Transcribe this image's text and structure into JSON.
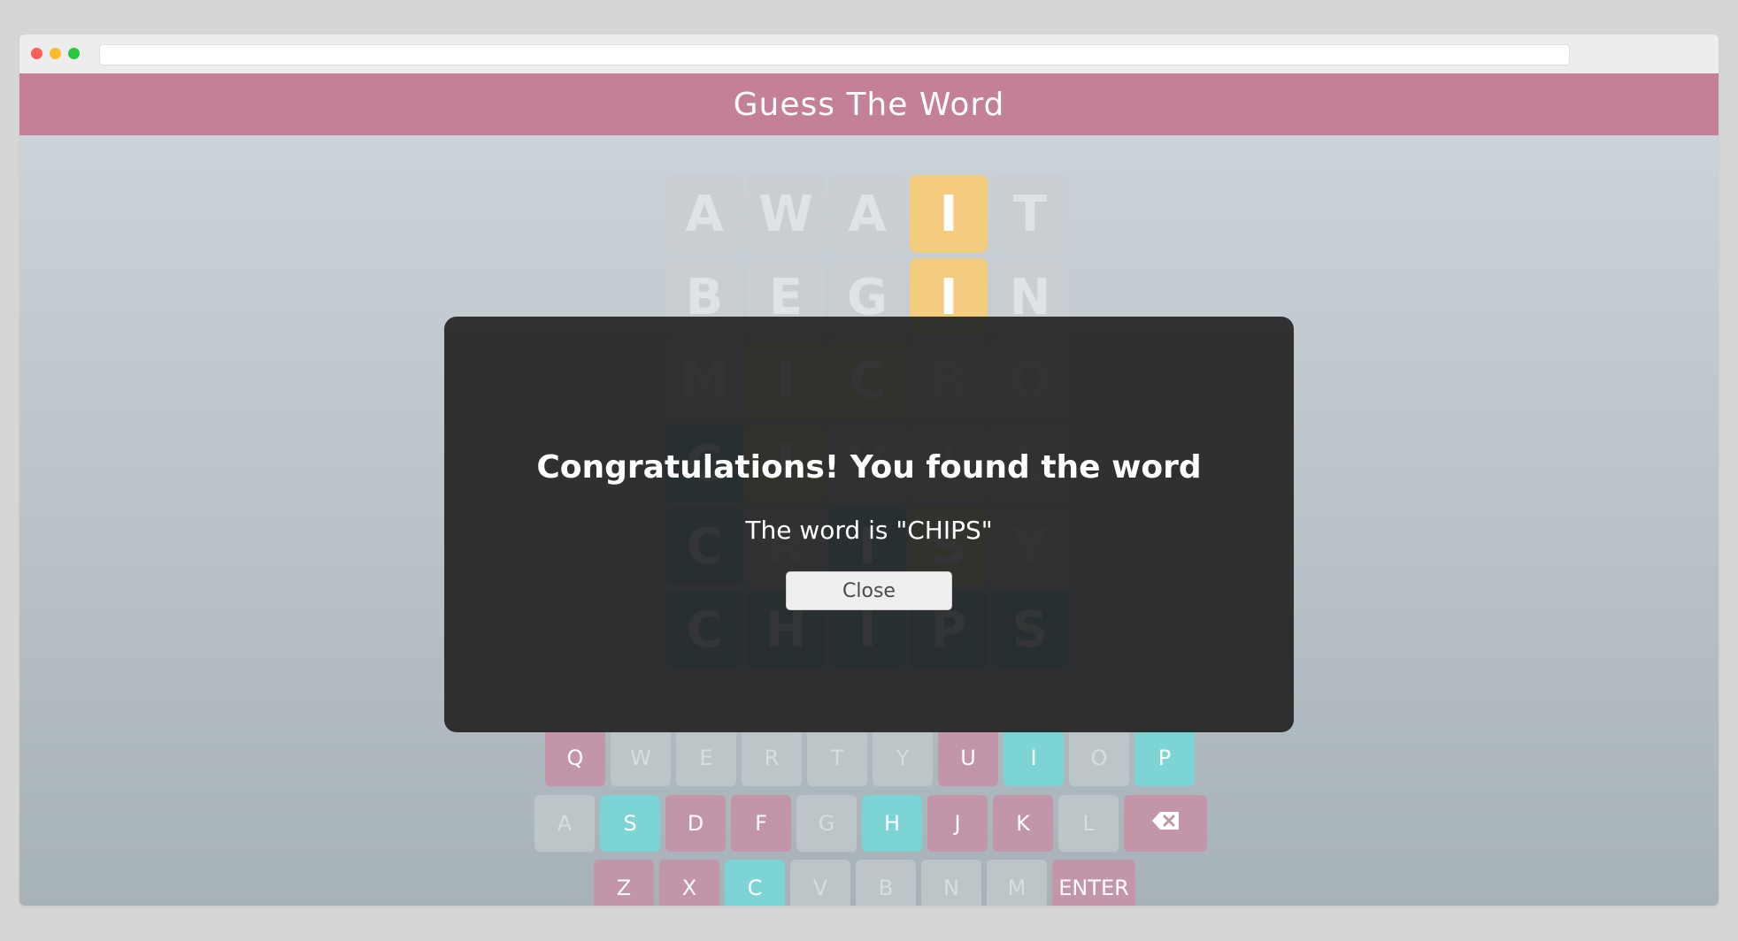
{
  "app": {
    "title": "Guess The Word"
  },
  "board": {
    "rows": [
      [
        {
          "l": "A",
          "s": "absent"
        },
        {
          "l": "W",
          "s": "absent"
        },
        {
          "l": "A",
          "s": "absent"
        },
        {
          "l": "I",
          "s": "present"
        },
        {
          "l": "T",
          "s": "absent"
        }
      ],
      [
        {
          "l": "B",
          "s": "absent"
        },
        {
          "l": "E",
          "s": "absent"
        },
        {
          "l": "G",
          "s": "absent"
        },
        {
          "l": "I",
          "s": "present"
        },
        {
          "l": "N",
          "s": "absent"
        }
      ],
      [
        {
          "l": "M",
          "s": "absent"
        },
        {
          "l": "I",
          "s": "present"
        },
        {
          "l": "C",
          "s": "present"
        },
        {
          "l": "R",
          "s": "absent"
        },
        {
          "l": "O",
          "s": "absent"
        }
      ],
      [
        {
          "l": "C",
          "s": "correct"
        },
        {
          "l": "I",
          "s": "present"
        },
        {
          "l": "V",
          "s": "absent"
        },
        {
          "l": "I",
          "s": "absent"
        },
        {
          "l": "L",
          "s": "absent"
        }
      ],
      [
        {
          "l": "C",
          "s": "correct"
        },
        {
          "l": "R",
          "s": "absent"
        },
        {
          "l": "I",
          "s": "correct"
        },
        {
          "l": "S",
          "s": "present"
        },
        {
          "l": "Y",
          "s": "absent"
        }
      ],
      [
        {
          "l": "C",
          "s": "correct"
        },
        {
          "l": "H",
          "s": "correct"
        },
        {
          "l": "I",
          "s": "correct"
        },
        {
          "l": "P",
          "s": "correct"
        },
        {
          "l": "S",
          "s": "correct"
        }
      ]
    ]
  },
  "keyboard": {
    "rows": [
      [
        {
          "k": "Q",
          "s": "pink"
        },
        {
          "k": "W",
          "s": "gray"
        },
        {
          "k": "E",
          "s": "gray"
        },
        {
          "k": "R",
          "s": "gray"
        },
        {
          "k": "T",
          "s": "gray"
        },
        {
          "k": "Y",
          "s": "gray"
        },
        {
          "k": "U",
          "s": "pink"
        },
        {
          "k": "I",
          "s": "teal"
        },
        {
          "k": "O",
          "s": "gray"
        },
        {
          "k": "P",
          "s": "teal"
        }
      ],
      [
        {
          "k": "A",
          "s": "gray"
        },
        {
          "k": "S",
          "s": "teal"
        },
        {
          "k": "D",
          "s": "pink"
        },
        {
          "k": "F",
          "s": "pink"
        },
        {
          "k": "G",
          "s": "gray"
        },
        {
          "k": "H",
          "s": "teal"
        },
        {
          "k": "J",
          "s": "pink"
        },
        {
          "k": "K",
          "s": "pink"
        },
        {
          "k": "L",
          "s": "gray"
        },
        {
          "k": "⌫",
          "s": "pink",
          "icon": "backspace-icon"
        }
      ],
      [
        {
          "k": "Z",
          "s": "pink"
        },
        {
          "k": "X",
          "s": "pink"
        },
        {
          "k": "C",
          "s": "teal"
        },
        {
          "k": "V",
          "s": "gray"
        },
        {
          "k": "B",
          "s": "gray"
        },
        {
          "k": "N",
          "s": "gray"
        },
        {
          "k": "M",
          "s": "gray"
        },
        {
          "k": "ENTER",
          "s": "pink"
        }
      ]
    ]
  },
  "modal": {
    "heading": "Congratulations! You found the word",
    "message": "The word is \"CHIPS\"",
    "close_label": "Close"
  },
  "colors": {
    "header": "#c48096",
    "present": "#f4cc80",
    "correct": "#6fb9b9",
    "key_pink": "#c295a8",
    "key_teal": "#7dd4d4"
  }
}
